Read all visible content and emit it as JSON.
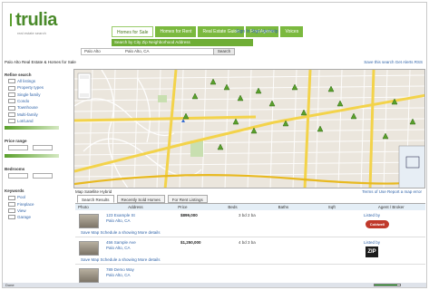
{
  "header": {
    "logo": "trulia",
    "logo_tagline": "real estate search",
    "tabs": [
      "Homes for Sale",
      "Homes for Rent",
      "Real Estate Guide",
      "Find Agents",
      "Voices"
    ],
    "toplink": "Sign In   Sign Up   Help",
    "subnav": "Search by City   Zip   Neighborhood   Address",
    "search_value": "Palo Alto",
    "search_value2": "Palo Alto, CA",
    "search_button": "Search"
  },
  "resultsbar": {
    "left": "Palo Alto Real Estate & Homes for Sale",
    "right": "Save this search   Get Alerts   RSS"
  },
  "sidebar": {
    "heading1": "Refine search",
    "items1": [
      "All listings",
      "Property types",
      "Single family",
      "Condo",
      "Townhouse",
      "Multi-family",
      "Lot/Land"
    ],
    "heading2": "Price range",
    "heading3": "Bedrooms",
    "heading4": "Keywords",
    "items4": [
      "Pool",
      "Fireplace",
      "View",
      "Garage"
    ]
  },
  "mapctl": {
    "left": "Map  Satellite  Hybrid",
    "right": "Terms of Use   Report a map error"
  },
  "result_tabs": [
    "Search Results",
    "Recently Sold Homes",
    "For Rent Listings"
  ],
  "table": {
    "headers": [
      "Photo",
      "Address",
      "Price",
      "Beds",
      "Baths",
      "Sqft",
      "Agent / Broker"
    ],
    "rows": [
      {
        "addr": "123 Example St",
        "addr2": "Palo Alto, CA",
        "price": "$899,000",
        "meta": "3 bd  2 ba",
        "agent": "Listed by",
        "logo": "Coldwell",
        "foot": "Save   Map   Schedule a showing   More details"
      },
      {
        "addr": "456 Sample Ave",
        "addr2": "Palo Alto, CA",
        "price": "$1,250,000",
        "meta": "4 bd  3 ba",
        "agent": "Listed by",
        "logo": "ZIP",
        "foot": "Save   Map   Schedule a showing   More details"
      },
      {
        "addr": "789 Demo Way",
        "addr2": "Palo Alto, CA",
        "price": "",
        "meta": "",
        "agent": "",
        "logo": "",
        "foot": ""
      }
    ]
  },
  "status": {
    "text": "Done",
    "progress": 0.9
  }
}
